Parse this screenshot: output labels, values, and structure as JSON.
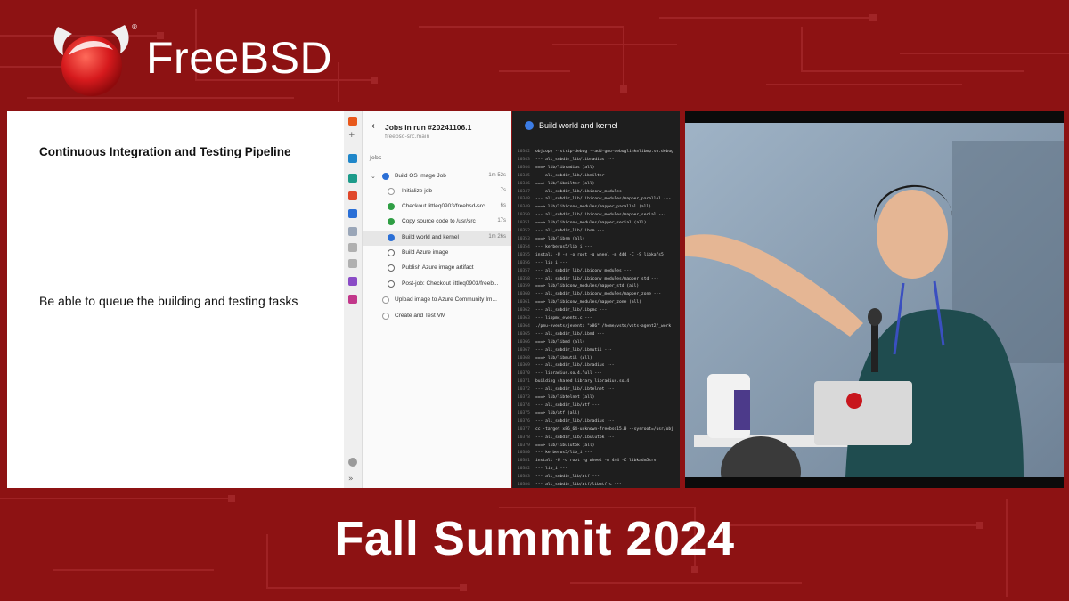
{
  "header": {
    "brand": "FreeBSD",
    "registered_mark": "®"
  },
  "slide": {
    "title": "Continuous Integration and Testing Pipeline",
    "body": "Be able to queue the building and testing tasks"
  },
  "ado": {
    "rail_add": "+",
    "rail_expand": "»",
    "back_arrow": "←",
    "jobs_title": "Jobs in run #20241106.1",
    "jobs_subtitle": "freebsd-src.main",
    "jobs_label": "Jobs",
    "rows": [
      {
        "label": "Build OS Image Job",
        "duration": "1m 52s",
        "status": "running",
        "chevron": "⌄"
      },
      {
        "label": "Initialize job",
        "duration": "7s",
        "status": "skipped"
      },
      {
        "label": "Checkout littleq0903/freebsd-src...",
        "duration": "6s",
        "status": "succeeded"
      },
      {
        "label": "Copy source code to /usr/src",
        "duration": "17s",
        "status": "succeeded"
      },
      {
        "label": "Build world and kernel",
        "duration": "1m 26s",
        "status": "running"
      },
      {
        "label": "Build Azure image",
        "duration": "",
        "status": "pending"
      },
      {
        "label": "Publish Azure image artifact",
        "duration": "",
        "status": "pending"
      },
      {
        "label": "Post-job: Checkout littleq0903/freeb...",
        "duration": "",
        "status": "pending"
      },
      {
        "label": "Upload image to Azure Community Im...",
        "duration": "",
        "status": "skipped"
      },
      {
        "label": "Create and Test VM",
        "duration": "",
        "status": "skipped"
      }
    ],
    "status_colors": {
      "succeeded": "#2f9e44",
      "running": "#2b6fd6"
    },
    "log_title": "Build world and kernel",
    "log_lines": [
      {
        "n": "10342",
        "t": "objcopy --strip-debug --add-gnu-debuglink=libmp.so.debug"
      },
      {
        "n": "10343",
        "t": "--- all_subdir_lib/libradius ---"
      },
      {
        "n": "10344",
        "t": "===> lib/libradius (all)"
      },
      {
        "n": "10345",
        "t": "--- all_subdir_lib/libmilter ---"
      },
      {
        "n": "10346",
        "t": "===> lib/libmilter (all)"
      },
      {
        "n": "10347",
        "t": "--- all_subdir_lib/libiconv_modules ---"
      },
      {
        "n": "10348",
        "t": "--- all_subdir_lib/libiconv_modules/mapper_parallel ---"
      },
      {
        "n": "10349",
        "t": "===> lib/libiconv_modules/mapper_parallel (all)"
      },
      {
        "n": "10350",
        "t": "--- all_subdir_lib/libiconv_modules/mapper_serial ---"
      },
      {
        "n": "10351",
        "t": "===> lib/libiconv_modules/mapper_serial (all)"
      },
      {
        "n": "10352",
        "t": "--- all_subdir_lib/libsm ---"
      },
      {
        "n": "10353",
        "t": "===> lib/libsm (all)"
      },
      {
        "n": "10354",
        "t": "--- kerberos5/lib_i ---"
      },
      {
        "n": "10355",
        "t": "install -U  -s -o root -g wheel -m 444  -C -S  libkafs5"
      },
      {
        "n": "10356",
        "t": "--- lib_i ---"
      },
      {
        "n": "10357",
        "t": "--- all_subdir_lib/libiconv_modules ---"
      },
      {
        "n": "10358",
        "t": "--- all_subdir_lib/libiconv_modules/mapper_std ---"
      },
      {
        "n": "10359",
        "t": "===> lib/libiconv_modules/mapper_std (all)"
      },
      {
        "n": "10360",
        "t": "--- all_subdir_lib/libiconv_modules/mapper_zone ---"
      },
      {
        "n": "10361",
        "t": "===> lib/libiconv_modules/mapper_zone (all)"
      },
      {
        "n": "10362",
        "t": "--- all_subdir_lib/libpmc ---"
      },
      {
        "n": "10363",
        "t": "--- libpmc_events.c ---"
      },
      {
        "n": "10364",
        "t": "./pmu-events/jevents \"x86\" /home/vsts/vsts-agent2/_work"
      },
      {
        "n": "10365",
        "t": "--- all_subdir_lib/libmd ---"
      },
      {
        "n": "10366",
        "t": "===> lib/libmd (all)"
      },
      {
        "n": "10367",
        "t": "--- all_subdir_lib/libmutil ---"
      },
      {
        "n": "10368",
        "t": "===> lib/libmutil (all)"
      },
      {
        "n": "10369",
        "t": "--- all_subdir_lib/libradius ---"
      },
      {
        "n": "10370",
        "t": "--- libradius.so.4.full ---"
      },
      {
        "n": "10371",
        "t": "building shared library libradius.so.4"
      },
      {
        "n": "10372",
        "t": "--- all_subdir_lib/libtelnet ---"
      },
      {
        "n": "10373",
        "t": "===> lib/libtelnet (all)"
      },
      {
        "n": "10374",
        "t": "--- all_subdir_lib/atf ---"
      },
      {
        "n": "10375",
        "t": "===> lib/atf (all)"
      },
      {
        "n": "10376",
        "t": "--- all_subdir_lib/libradius ---"
      },
      {
        "n": "10377",
        "t": "cc -target x86_64-unknown-freebsd15.0 --sysroot=/usr/obj"
      },
      {
        "n": "10378",
        "t": "--- all_subdir_lib/libulutok ---"
      },
      {
        "n": "10379",
        "t": "===> lib/libulutok (all)"
      },
      {
        "n": "10380",
        "t": "--- kerberos5/lib_i ---"
      },
      {
        "n": "10381",
        "t": "install -U -o root -g wheel -m 444  -C  libkadm5srv"
      },
      {
        "n": "10382",
        "t": "--- lib_i ---"
      },
      {
        "n": "10383",
        "t": "--- all_subdir_lib/atf ---"
      },
      {
        "n": "10384",
        "t": "--- all_subdir_lib/atf/libatf-c ---"
      }
    ]
  },
  "footer": {
    "title": "Fall Summit 2024"
  },
  "colors": {
    "background": "#8d1213",
    "accent_red": "#c8161d",
    "azure_blue": "#2b6fd6"
  }
}
